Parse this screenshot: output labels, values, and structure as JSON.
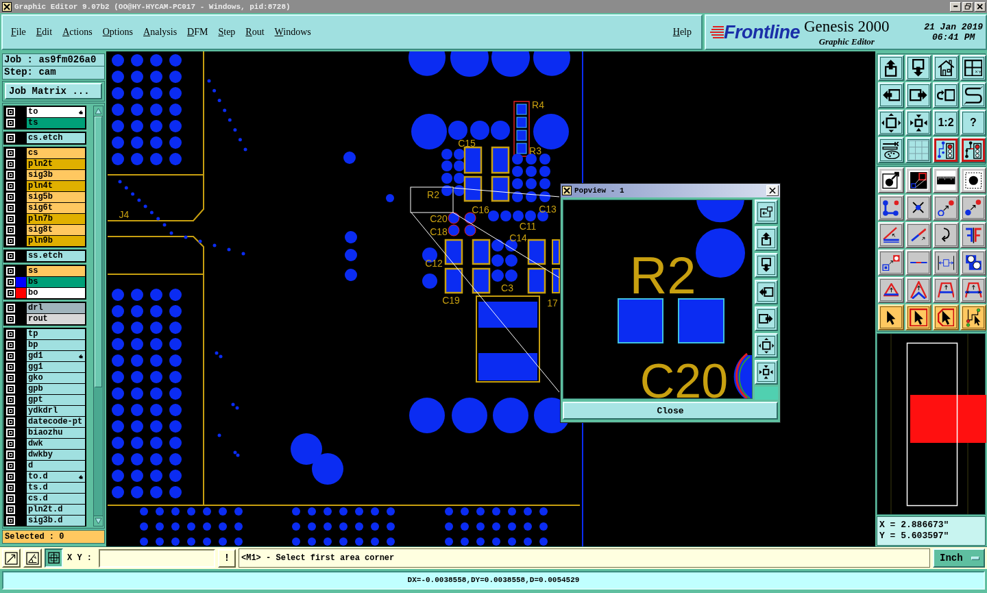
{
  "window": {
    "title": "Graphic Editor 9.07b2 (OO@HY-HYCAM-PC017 - Windows, pid:8728)"
  },
  "menu": {
    "items": [
      {
        "label": "File"
      },
      {
        "label": "Edit"
      },
      {
        "label": "Actions"
      },
      {
        "label": "Options"
      },
      {
        "label": "Analysis"
      },
      {
        "label": "DFM"
      },
      {
        "label": "Step"
      },
      {
        "label": "Rout"
      },
      {
        "label": "Windows"
      }
    ],
    "help": "Help"
  },
  "branding": {
    "logo": "Frontline",
    "product": "Genesis 2000",
    "module": "Graphic Editor",
    "date": "21 Jan 2019",
    "time": "06:41 PM"
  },
  "job_panel": {
    "job": "Job : as9fm026a0",
    "step": "Step: cam",
    "matrix_button": "Job Matrix ...",
    "selected_count": "Selected : 0"
  },
  "layer_groups": [
    {
      "layers": [
        {
          "name": "to",
          "checked": false,
          "color": "#ffffff",
          "marked": true
        },
        {
          "name": "ts",
          "checked": false,
          "color": "#00a078",
          "marked": false
        }
      ]
    },
    {
      "layers": [
        {
          "name": "cs.etch",
          "checked": false,
          "color": "#a0e0e0",
          "marked": false
        }
      ]
    },
    {
      "layers": [
        {
          "name": "cs",
          "checked": false,
          "color": "#ffc860",
          "marked": false
        },
        {
          "name": "pln2t",
          "checked": false,
          "color": "#e0b000",
          "marked": false
        },
        {
          "name": "sig3b",
          "checked": false,
          "color": "#ffc860",
          "marked": false
        },
        {
          "name": "pln4t",
          "checked": false,
          "color": "#e0b000",
          "marked": false
        },
        {
          "name": "sig5b",
          "checked": false,
          "color": "#ffc860",
          "marked": false
        },
        {
          "name": "sig6t",
          "checked": false,
          "color": "#ffc860",
          "marked": false
        },
        {
          "name": "pln7b",
          "checked": false,
          "color": "#e0b000",
          "marked": false
        },
        {
          "name": "sig8t",
          "checked": false,
          "color": "#ffc860",
          "marked": false
        },
        {
          "name": "pln9b",
          "checked": false,
          "color": "#e0b000",
          "marked": false
        }
      ]
    },
    {
      "layers": [
        {
          "name": "ss.etch",
          "checked": false,
          "color": "#a0e0e0",
          "marked": false
        }
      ]
    },
    {
      "layers": [
        {
          "name": "ss",
          "checked": false,
          "color": "#ffc860",
          "marked": false
        },
        {
          "name": "bs",
          "checked": false,
          "color": "#00a078",
          "marked": false,
          "swatch": {
            "color": "#0000ff"
          }
        },
        {
          "name": "bo",
          "checked": false,
          "color": "#ffffff",
          "marked": false,
          "swatch": {
            "color": "#ff0000"
          }
        }
      ]
    },
    {
      "layers": [
        {
          "name": "drl",
          "checked": false,
          "color": "#a0b4bc",
          "marked": false
        },
        {
          "name": "rout",
          "checked": false,
          "color": "#d8d8d8",
          "marked": false
        }
      ]
    },
    {
      "layers": [
        {
          "name": "tp",
          "checked": false,
          "color": "#a0e0e0",
          "marked": false
        },
        {
          "name": "bp",
          "checked": false,
          "color": "#a0e0e0",
          "marked": false
        },
        {
          "name": "gd1",
          "checked": false,
          "color": "#a0e0e0",
          "marked": true
        },
        {
          "name": "gg1",
          "checked": false,
          "color": "#a0e0e0",
          "marked": false
        },
        {
          "name": "gko",
          "checked": false,
          "color": "#a0e0e0",
          "marked": false
        },
        {
          "name": "gpb",
          "checked": false,
          "color": "#a0e0e0",
          "marked": false
        },
        {
          "name": "gpt",
          "checked": false,
          "color": "#a0e0e0",
          "marked": false
        },
        {
          "name": "ydkdrl",
          "checked": false,
          "color": "#a0e0e0",
          "marked": false
        },
        {
          "name": "datecode-pt",
          "checked": false,
          "color": "#a0e0e0",
          "marked": false
        },
        {
          "name": "biaozhu",
          "checked": false,
          "color": "#a0e0e0",
          "marked": false
        },
        {
          "name": "dwk",
          "checked": false,
          "color": "#a0e0e0",
          "marked": false
        },
        {
          "name": "dwkby",
          "checked": false,
          "color": "#a0e0e0",
          "marked": false
        },
        {
          "name": "d",
          "checked": false,
          "color": "#a0e0e0",
          "marked": false
        },
        {
          "name": "to.d",
          "checked": false,
          "color": "#a0e0e0",
          "marked": true
        },
        {
          "name": "ts.d",
          "checked": false,
          "color": "#a0e0e0",
          "marked": false
        },
        {
          "name": "cs.d",
          "checked": false,
          "color": "#a0e0e0",
          "marked": false
        },
        {
          "name": "pln2t.d",
          "checked": false,
          "color": "#a0e0e0",
          "marked": false
        },
        {
          "name": "sig3b.d",
          "checked": false,
          "color": "#a0e0e0",
          "marked": false
        }
      ]
    }
  ],
  "canvas": {
    "labels": [
      "R4",
      "C15",
      "R3",
      "R2",
      "C16",
      "C13",
      "J4",
      "C20",
      "C11",
      "C18",
      "C14",
      "C12",
      "C3",
      "C19",
      "17"
    ]
  },
  "popview": {
    "title": "Popview - 1",
    "labels": [
      "R2",
      "C20"
    ],
    "close_button": "Close"
  },
  "toolbar": {
    "sections": [
      {
        "rows": [
          {
            "kind": "teal",
            "buttons": [
              {
                "active": false
              },
              {
                "active": false
              },
              {
                "active": false
              },
              {
                "active": false
              }
            ]
          },
          {
            "kind": "teal",
            "buttons": [
              {
                "active": false
              },
              {
                "active": false
              },
              {
                "active": false
              },
              {
                "active": false
              }
            ]
          },
          {
            "kind": "teal",
            "buttons": [
              {
                "active": false
              },
              {
                "active": false
              },
              {
                "active": false,
                "label": "1:2"
              },
              {
                "active": false,
                "label": "?"
              }
            ]
          },
          {
            "kind": "teal",
            "buttons": [
              {
                "active": false
              },
              {
                "active": false
              },
              {
                "active": true
              },
              {
                "active": true
              }
            ]
          }
        ]
      },
      {
        "rows": [
          {
            "kind": "white",
            "buttons": [
              {
                "active": false
              },
              {
                "active": false
              },
              {
                "active": false
              },
              {
                "active": false
              }
            ]
          },
          {
            "kind": "gray",
            "buttons": [
              {
                "active": false
              },
              {
                "active": false
              },
              {
                "active": false
              },
              {
                "active": false
              }
            ]
          },
          {
            "kind": "gray",
            "buttons": [
              {
                "active": false
              },
              {
                "active": false
              },
              {
                "active": false
              },
              {
                "active": false
              }
            ]
          },
          {
            "kind": "gray",
            "buttons": [
              {
                "active": false
              },
              {
                "active": false
              },
              {
                "active": false
              },
              {
                "active": false
              }
            ]
          },
          {
            "kind": "gray",
            "buttons": [
              {
                "active": false
              },
              {
                "active": false
              },
              {
                "active": false
              },
              {
                "active": false
              }
            ]
          },
          {
            "kind": "orange",
            "buttons": [
              {
                "active": false
              },
              {
                "active": false
              },
              {
                "active": false
              },
              {
                "active": false
              }
            ]
          }
        ]
      }
    ]
  },
  "overview": {
    "x": "X = 2.886673\"",
    "y": "Y = 5.603597\""
  },
  "command_bar": {
    "tools": [
      {
        "selected": false
      },
      {
        "selected": false
      },
      {
        "selected": true
      }
    ],
    "xy_label": "X Y :",
    "alert": "!",
    "prompt": "<M1> - Select first area corner",
    "units": "Inch"
  },
  "status_bar": {
    "text": "DX=-0.0038558,DY=0.0038558,D=0.0054529"
  }
}
